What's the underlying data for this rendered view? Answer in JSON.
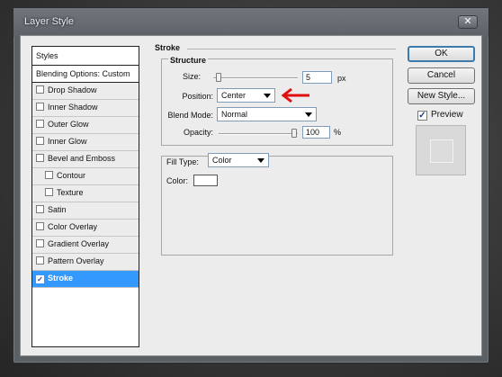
{
  "window": {
    "title": "Layer Style",
    "close_glyph": "✕"
  },
  "styles_panel": {
    "header": "Styles",
    "blending": "Blending Options: Custom",
    "items": [
      {
        "label": "Drop Shadow",
        "checked": false
      },
      {
        "label": "Inner Shadow",
        "checked": false
      },
      {
        "label": "Outer Glow",
        "checked": false
      },
      {
        "label": "Inner Glow",
        "checked": false
      },
      {
        "label": "Bevel and Emboss",
        "checked": false
      },
      {
        "label": "Contour",
        "checked": false
      },
      {
        "label": "Texture",
        "checked": false
      },
      {
        "label": "Satin",
        "checked": false
      },
      {
        "label": "Color Overlay",
        "checked": false
      },
      {
        "label": "Gradient Overlay",
        "checked": false
      },
      {
        "label": "Pattern Overlay",
        "checked": false
      },
      {
        "label": "Stroke",
        "checked": true
      }
    ],
    "check_glyph": "✓"
  },
  "stroke": {
    "title": "Stroke",
    "structure_title": "Structure",
    "size_label": "Size:",
    "size_value": "5",
    "size_unit": "px",
    "position_label": "Position:",
    "position_value": "Center",
    "blend_mode_label": "Blend Mode:",
    "blend_mode_value": "Normal",
    "opacity_label": "Opacity:",
    "opacity_value": "100",
    "opacity_unit": "%",
    "fill_type_label": "Fill Type:",
    "fill_type_value": "Color",
    "color_label": "Color:",
    "color_value": "#ffffff"
  },
  "buttons": {
    "ok": "OK",
    "cancel": "Cancel",
    "new_style": "New Style...",
    "preview_label": "Preview",
    "preview_checked": true
  },
  "annotation": {
    "arrow_color": "#e01010"
  }
}
